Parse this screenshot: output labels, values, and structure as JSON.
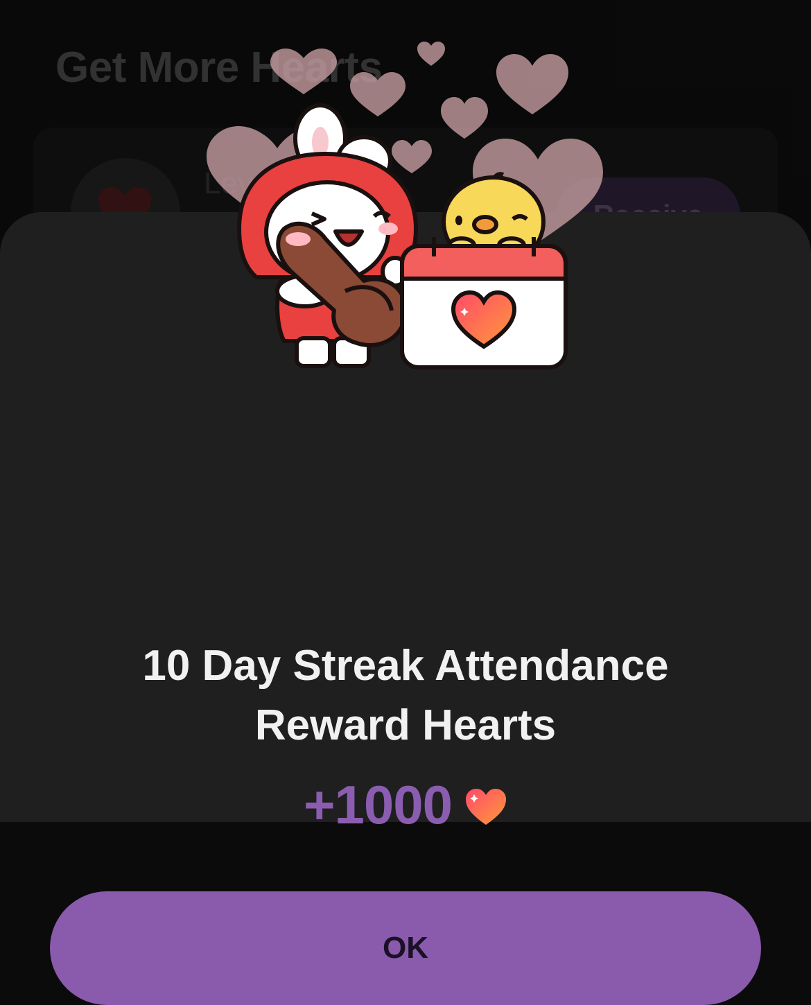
{
  "background": {
    "title": "Get More Hearts",
    "card_label": "Lev",
    "receive_label": "Receive"
  },
  "modal": {
    "title_line1": "10 Day Streak Attendance",
    "title_line2": "Reward Hearts",
    "amount": "+1000",
    "amount_icon": "heart-icon",
    "ok_label": "OK"
  },
  "colors": {
    "accent_purple": "#8a5aac",
    "amount_purple": "#8b5db0",
    "sheet_bg": "#1f1f1f",
    "heart_red": "#f14b4b"
  }
}
